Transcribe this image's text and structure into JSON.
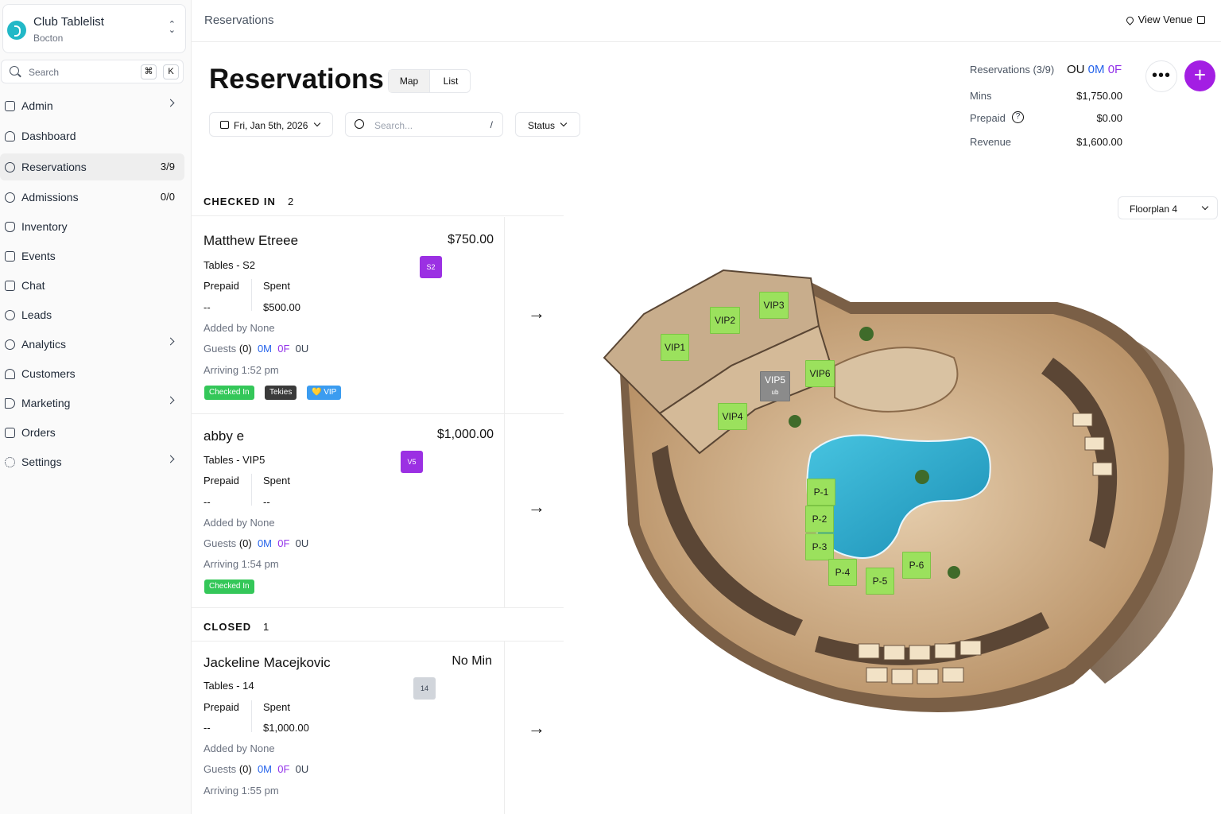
{
  "org": {
    "name": "Club Tablelist",
    "location": "Bocton"
  },
  "search": {
    "placeholder": "Search",
    "kbd1": "⌘",
    "kbd2": "K"
  },
  "nav": [
    {
      "label": "Admin",
      "chevron": true,
      "badge": ""
    },
    {
      "label": "Dashboard",
      "chevron": false,
      "badge": ""
    },
    {
      "label": "Reservations",
      "chevron": false,
      "badge": "3/9",
      "active": true
    },
    {
      "label": "Admissions",
      "chevron": false,
      "badge": "0/0"
    },
    {
      "label": "Inventory",
      "chevron": false,
      "badge": ""
    },
    {
      "label": "Events",
      "chevron": false,
      "badge": ""
    },
    {
      "label": "Chat",
      "chevron": false,
      "badge": ""
    },
    {
      "label": "Leads",
      "chevron": false,
      "badge": ""
    },
    {
      "label": "Analytics",
      "chevron": true,
      "badge": ""
    },
    {
      "label": "Customers",
      "chevron": false,
      "badge": ""
    },
    {
      "label": "Marketing",
      "chevron": true,
      "badge": ""
    },
    {
      "label": "Orders",
      "chevron": false,
      "badge": ""
    },
    {
      "label": "Settings",
      "chevron": true,
      "badge": ""
    }
  ],
  "topbar": {
    "breadcrumb": "Reservations",
    "view_venue": "View Venue"
  },
  "header": {
    "title": "Reservations",
    "view_map": "Map",
    "view_list": "List",
    "date": "Fri, Jan 5th, 2026",
    "search_placeholder": "Search...",
    "search_kbd": "/",
    "status": "Status"
  },
  "stats": {
    "reservations_label": "Reservations (3/9)",
    "ou": "OU",
    "om": "0M",
    "of": "0F",
    "mins_label": "Mins",
    "mins_value": "$1,750.00",
    "prepaid_label": "Prepaid",
    "prepaid_value": "$0.00",
    "revenue_label": "Revenue",
    "revenue_value": "$1,600.00"
  },
  "floorplan": "Floorplan 4",
  "sections": {
    "checked_in": {
      "title": "CHECKED IN",
      "count": "2"
    },
    "closed": {
      "title": "CLOSED",
      "count": "1"
    }
  },
  "labels": {
    "prepaid": "Prepaid",
    "spent": "Spent",
    "guests": "Guests",
    "guests_count": "(0)",
    "om": "0M",
    "of": "0F",
    "ou": "0U"
  },
  "reservations": [
    {
      "name": "Matthew Etreee",
      "amount": "$750.00",
      "tables": "Tables - S2",
      "chip": "S2",
      "chip_color": "#9b30e3",
      "prepaid": "--",
      "spent": "$500.00",
      "added_by": "Added by None",
      "arriving": "Arriving 1:52 pm",
      "tags": [
        "Checked In",
        "Tekies",
        "💛 VIP"
      ]
    },
    {
      "name": "abby e",
      "amount": "$1,000.00",
      "tables": "Tables - VIP5",
      "chip": "V5",
      "chip_color": "#9b30e3",
      "prepaid": "--",
      "spent": "--",
      "added_by": "Added by None",
      "arriving": "Arriving 1:54 pm",
      "tags": [
        "Checked In"
      ]
    },
    {
      "name": "Jackeline Macejkovic",
      "amount": "No Min",
      "tables": "Tables - 14",
      "chip": "14",
      "chip_color": "#d1d5db",
      "prepaid": "--",
      "spent": "$1,000.00",
      "added_by": "Added by None",
      "arriving": "Arriving 1:55 pm",
      "tags": []
    }
  ],
  "map_markers": [
    "VIP1",
    "VIP2",
    "VIP3",
    "VIP4",
    "VIP5",
    "VIP6",
    "P-1",
    "P-2",
    "P-3",
    "P-4",
    "P-5",
    "P-6"
  ],
  "map_marker_vip5_sub": "ub",
  "colors": {
    "accent": "#a31ee3",
    "marker": "#9be15d",
    "checked_in": "#34c759",
    "tekies": "#3a3a3a",
    "vip": "#3b9cf0"
  }
}
